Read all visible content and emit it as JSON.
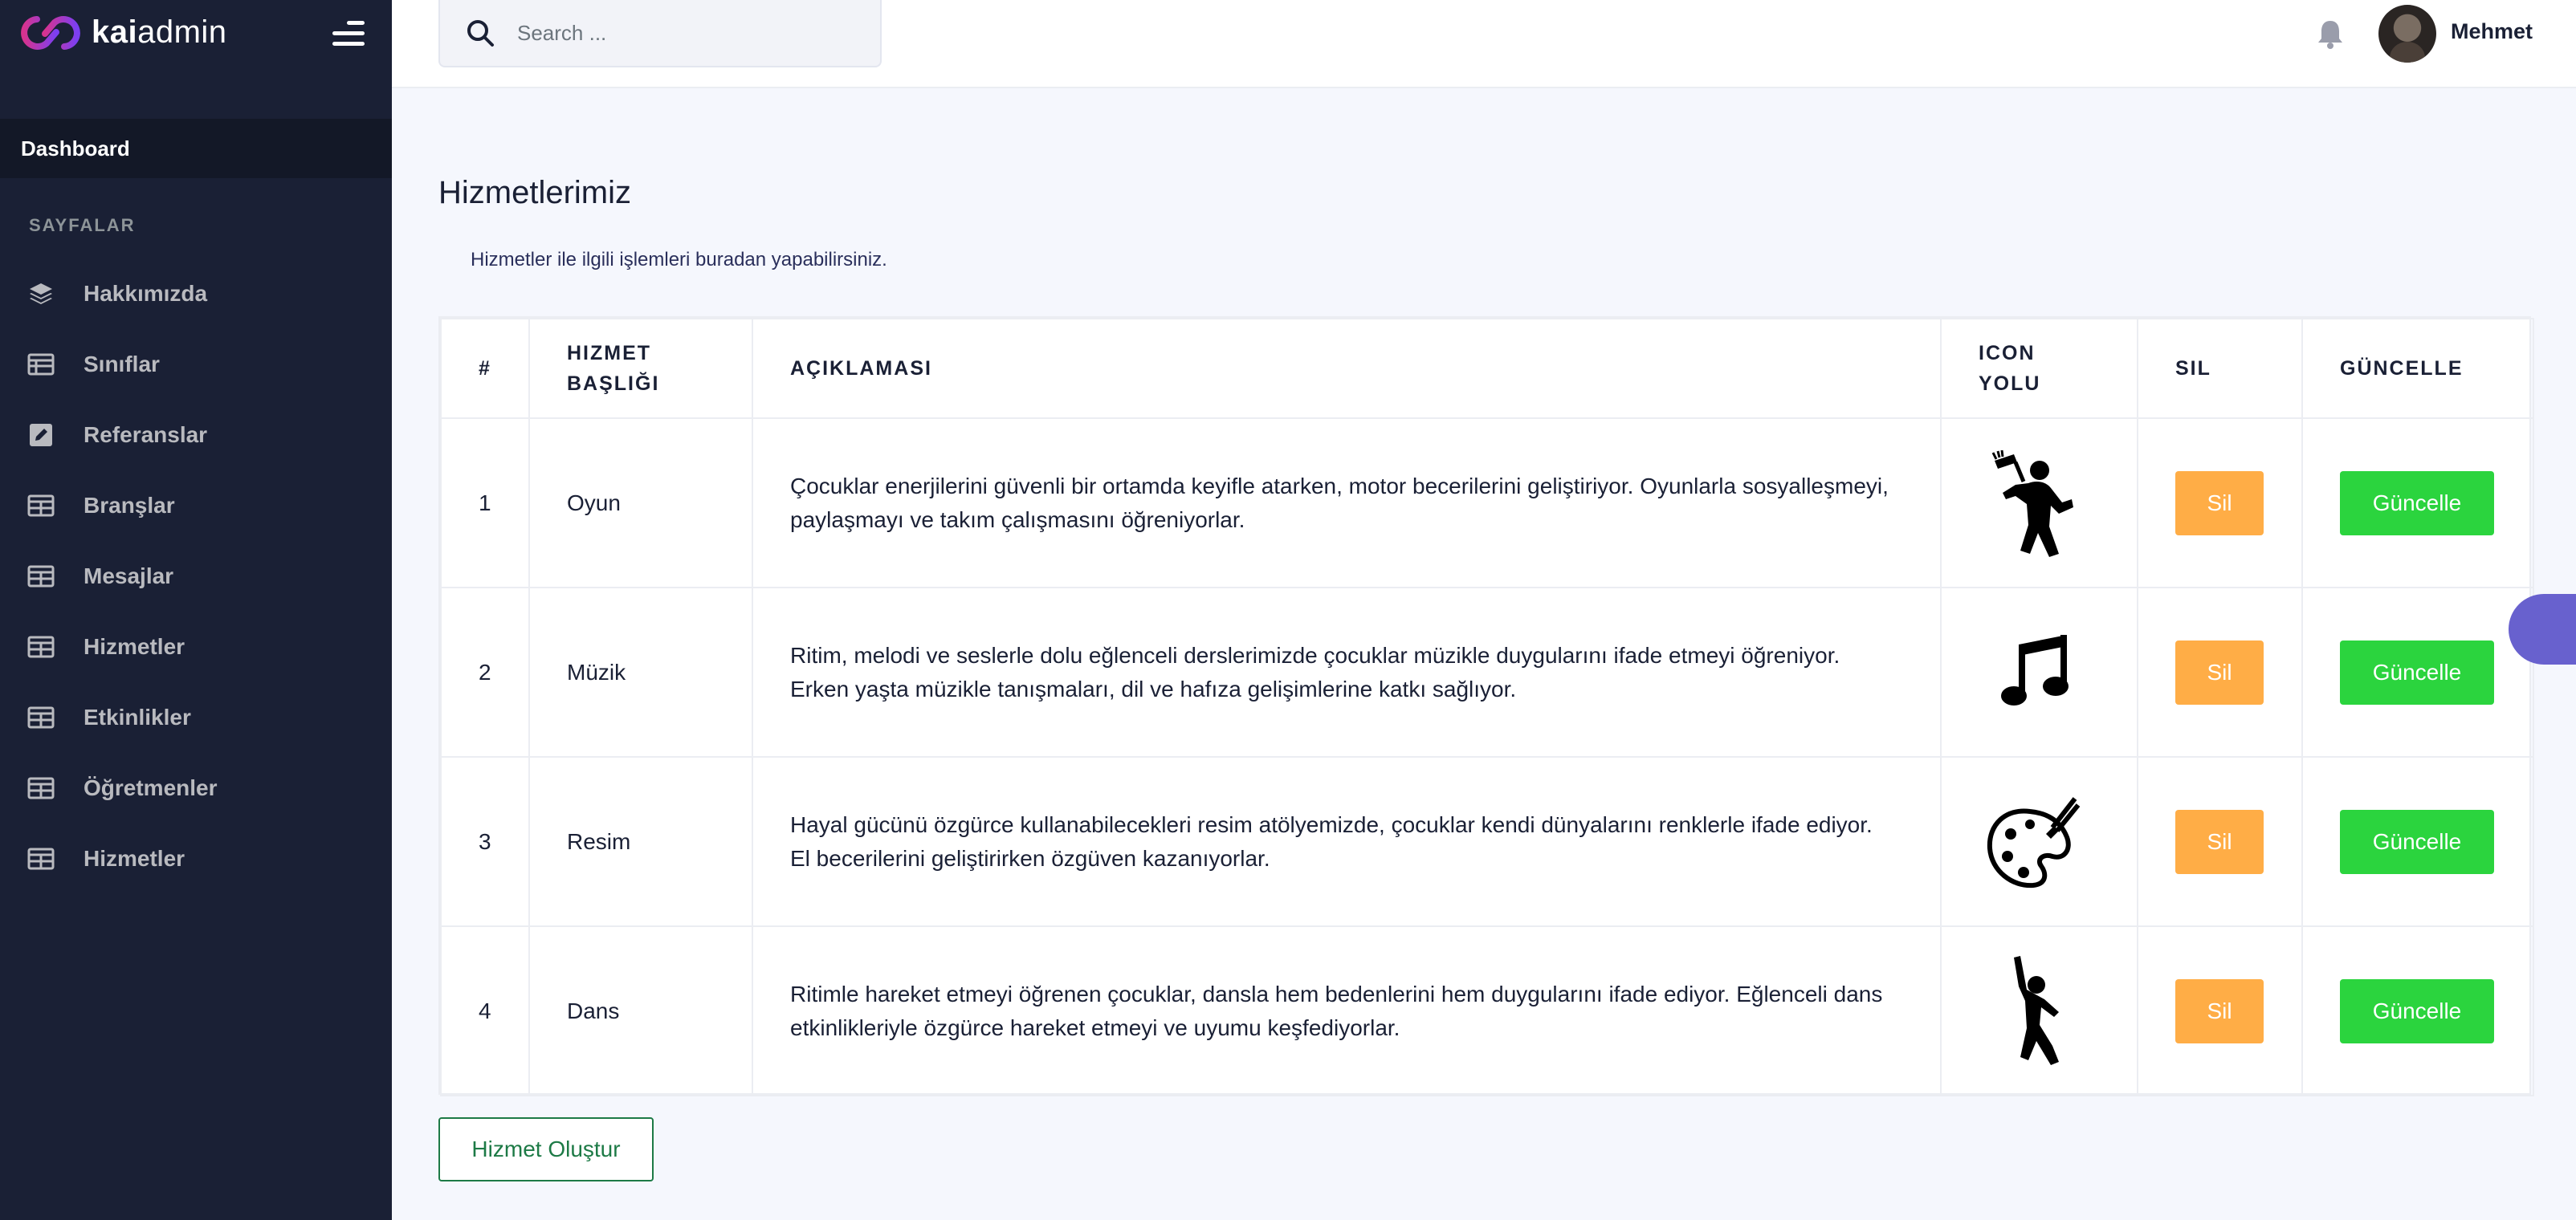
{
  "brand": {
    "bold": "kai",
    "light": "admin",
    "accent": "#a735f2"
  },
  "sidebar": {
    "dashboard": "Dashboard",
    "section_title": "SAYFALAR",
    "items": [
      {
        "label": "Hakkımızda",
        "icon": "layers-icon"
      },
      {
        "label": "Sınıflar",
        "icon": "list-table-icon"
      },
      {
        "label": "Referanslar",
        "icon": "edit-square-icon"
      },
      {
        "label": "Branşlar",
        "icon": "table-icon"
      },
      {
        "label": "Mesajlar",
        "icon": "table-icon"
      },
      {
        "label": "Hizmetler",
        "icon": "table-icon"
      },
      {
        "label": "Etkinlikler",
        "icon": "table-icon"
      },
      {
        "label": "Öğretmenler",
        "icon": "table-icon"
      },
      {
        "label": "Hizmetler",
        "icon": "table-icon"
      }
    ]
  },
  "header": {
    "search_placeholder": "Search ...",
    "user_name": "Mehmet"
  },
  "page": {
    "title": "Hizmetlerimiz",
    "subtitle": "Hizmetler ile ilgili işlemleri buradan yapabilirsiniz."
  },
  "table": {
    "headers": {
      "no": "#",
      "title_line1": "HIZMET",
      "title_line2": "BAŞLIĞI",
      "description": "AÇIKLAMASI",
      "icon_line1": "ICON",
      "icon_line2": "YOLU",
      "delete": "SIL",
      "update": "GÜNCELLE"
    },
    "rows": [
      {
        "no": "1",
        "title": "Oyun",
        "description": "Çocuklar enerjilerini güvenli bir ortamda keyifle atarken, motor becerilerini geliştiriyor. Oyunlarla sosyalleşmeyi, paylaşmayı ve takım çalışmasını öğreniyorlar.",
        "icon": "playing-child-icon",
        "delete_label": "Sil",
        "update_label": "Güncelle"
      },
      {
        "no": "2",
        "title": "Müzik",
        "description": "Ritim, melodi ve seslerle dolu eğlenceli derslerimizde çocuklar müzikle duygularını ifade etmeyi öğreniyor. Erken yaşta müzikle tanışmaları, dil ve hafıza gelişimlerine katkı sağlıyor.",
        "icon": "music-note-icon",
        "delete_label": "Sil",
        "update_label": "Güncelle"
      },
      {
        "no": "3",
        "title": "Resim",
        "description": "Hayal gücünü özgürce kullanabilecekleri resim atölyemizde, çocuklar kendi dünyalarını renklerle ifade ediyor. El becerilerini geliştirirken özgüven kazanıyorlar.",
        "icon": "paint-palette-icon",
        "delete_label": "Sil",
        "update_label": "Güncelle"
      },
      {
        "no": "4",
        "title": "Dans",
        "description": "Ritimle hareket etmeyi öğrenen çocuklar, dansla hem bedenlerini hem duygularını ifade ediyor. Eğlenceli dans etkinlikleriyle özgürce hareket etmeyi ve uyumu keşfediyorlar.",
        "icon": "dancer-icon",
        "delete_label": "Sil",
        "update_label": "Güncelle"
      }
    ]
  },
  "actions": {
    "create_label": "Hizmet Oluştur"
  },
  "colors": {
    "sidebar": "#1a2035",
    "delete": "#ffad46",
    "update": "#2bd43e",
    "create": "#1d7a46",
    "float": "#6861ce"
  }
}
